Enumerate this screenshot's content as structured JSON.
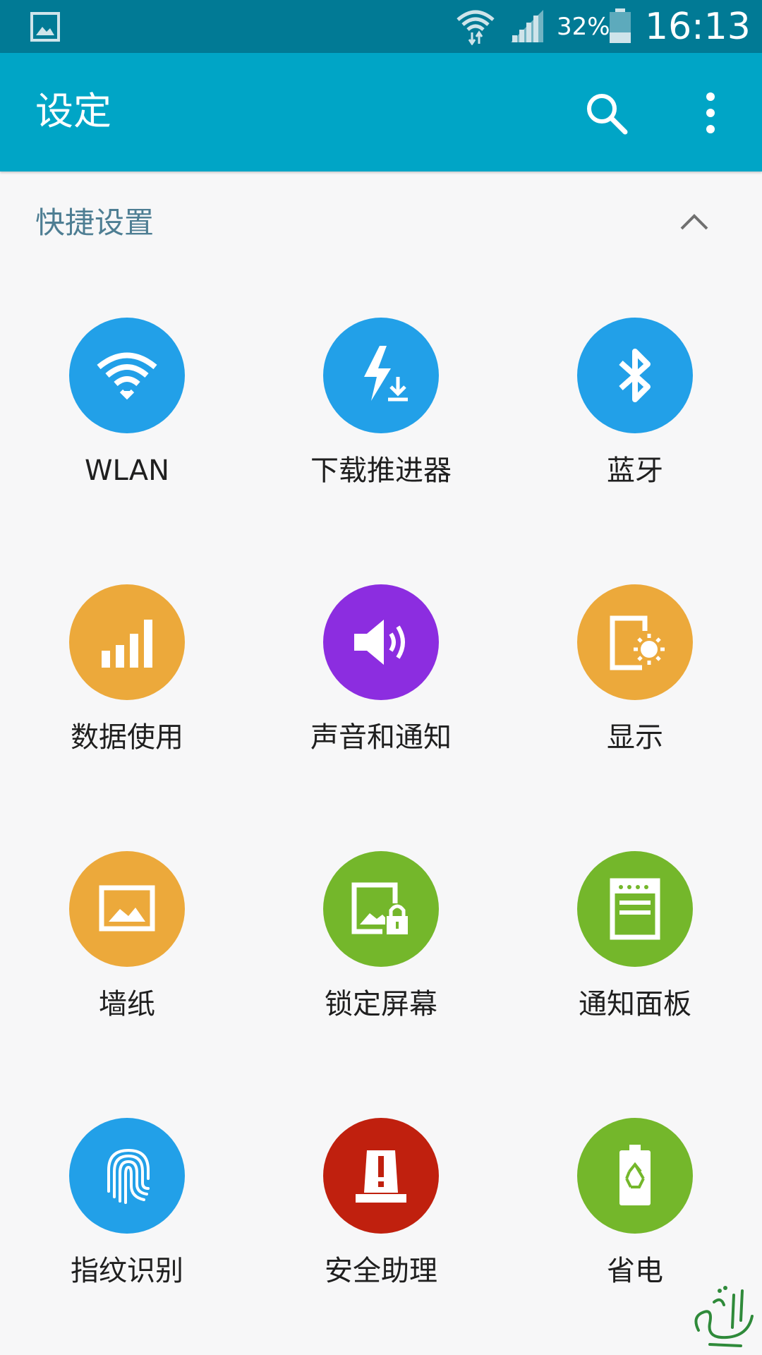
{
  "status_bar": {
    "battery_percent": "32%",
    "time": "16:13",
    "icons": [
      "gallery-notification-icon",
      "wifi-icon",
      "signal-icon",
      "battery-icon"
    ]
  },
  "action_bar": {
    "title": "设定",
    "icons": [
      "search-icon",
      "more-options-icon"
    ]
  },
  "quick_settings": {
    "header": "快捷设置",
    "collapse_icon": "chevron-up-icon",
    "items": [
      {
        "label": "WLAN",
        "icon": "wifi-icon",
        "color": "#22a0e8"
      },
      {
        "label": "下载推进器",
        "icon": "download-booster-icon",
        "color": "#22a0e8"
      },
      {
        "label": "蓝牙",
        "icon": "bluetooth-icon",
        "color": "#22a0e8"
      },
      {
        "label": "数据使用",
        "icon": "data-usage-icon",
        "color": "#eca93b"
      },
      {
        "label": "声音和通知",
        "icon": "volume-icon",
        "color": "#8c2de0"
      },
      {
        "label": "显示",
        "icon": "display-icon",
        "color": "#eca93b"
      },
      {
        "label": "墙纸",
        "icon": "wallpaper-icon",
        "color": "#eca93b"
      },
      {
        "label": "锁定屏幕",
        "icon": "lock-screen-icon",
        "color": "#74b72b"
      },
      {
        "label": "通知面板",
        "icon": "notification-panel-icon",
        "color": "#74b72b"
      },
      {
        "label": "指纹识别",
        "icon": "fingerprint-icon",
        "color": "#22a0e8"
      },
      {
        "label": "安全助理",
        "icon": "safety-alert-icon",
        "color": "#c0200e"
      },
      {
        "label": "省电",
        "icon": "battery-recycle-icon",
        "color": "#74b72b"
      }
    ]
  }
}
